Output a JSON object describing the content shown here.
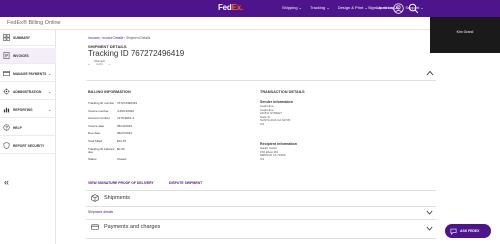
{
  "header": {
    "logo_main": "Fed",
    "logo_ex": "Ex.",
    "nav": [
      "Shipping ⌄",
      "Tracking ⌄",
      "Design & Print ⌄",
      "Locations ⌄",
      "Support ⌄"
    ],
    "signin": "Sign Up or Log In",
    "accent": "#4d148c",
    "brand_orange": "#ff6200"
  },
  "app": {
    "title": "FedEx® Billing Online"
  },
  "video": {
    "participant": "Kim Grand"
  },
  "sidebar": {
    "items": [
      {
        "label": "SUMMARY",
        "icon": "grid-icon"
      },
      {
        "label": "INVOICES",
        "icon": "invoice-icon"
      },
      {
        "label": "MANAGE PAYMENTS",
        "icon": "payment-icon"
      },
      {
        "label": "ADMINISTRATION",
        "icon": "admin-icon"
      },
      {
        "label": "REPORTING",
        "icon": "reporting-icon"
      },
      {
        "label": "HELP",
        "icon": "help-icon"
      },
      {
        "label": "REPORT SECURITY",
        "icon": "security-icon"
      }
    ],
    "collapse": "«"
  },
  "breadcrumb": {
    "home": "Invoices",
    "sep1": " › ",
    "mid": "Invoice Details",
    "sep2": " › ",
    "current": "Shipment Details"
  },
  "shipment": {
    "heading": "SHIPMENT DETAILS",
    "tracking_title": "Tracking ID 767272496419",
    "pager_label": "Shipment",
    "pager_count": "1 of 1"
  },
  "billing": {
    "heading": "BILLING INFORMATION",
    "rows": [
      {
        "k": "Tracking ID number",
        "v": "767272496419"
      },
      {
        "k": "Invoice number",
        "v": "4-609-20092"
      },
      {
        "k": "Account number",
        "v": "7275-9661-4"
      },
      {
        "k": "Invoice date",
        "v": "05/12/2024"
      },
      {
        "k": "Due date",
        "v": "05/27/2024"
      },
      {
        "k": "Total billed",
        "v": "$12.87"
      },
      {
        "k": "Tracking ID balance due",
        "v": "$0.00"
      },
      {
        "k": "Status",
        "v": "Closed"
      }
    ]
  },
  "transaction": {
    "heading": "TRANSACTION DETAILS",
    "sender_title": "Sender information",
    "sender_lines": [
      "Capheline",
      "Capheline",
      "2118 E STREET",
      "Suite R",
      "SANTA ANA CA 92705",
      "US"
    ],
    "recipient_title": "Recipient information",
    "recipient_lines": [
      "Sarah Carter",
      "150 Elson Rd",
      "MERION LA 71569",
      "US"
    ]
  },
  "links": {
    "view_pod": "VIEW SIGNATURE PROOF OF DELIVERY",
    "dispute": "DISPUTE SHIPMENT"
  },
  "accordions": {
    "shipments": "Shipments",
    "shipment_details": "Shipment details",
    "payments": "Payments and charges"
  },
  "ask_fedex": "ASK FEDEX"
}
